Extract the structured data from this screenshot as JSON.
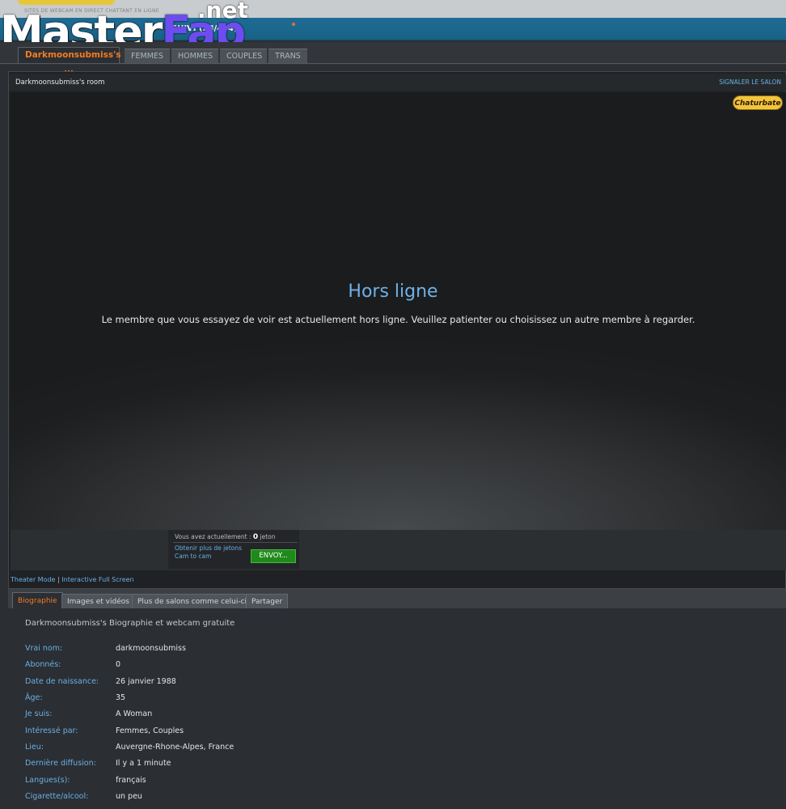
{
  "header": {
    "tagline": "SITES DE WEBCAM EN DIRECT CHATTANT EN LIGNE",
    "followed_label": "SUIVI (28/464)",
    "watermark_left": "Master",
    "watermark_fap": "Fap",
    "watermark_net": ".net"
  },
  "tabs": [
    {
      "label": "Darkmoonsubmiss's ...",
      "active": true
    },
    {
      "label": "FEMMES"
    },
    {
      "label": "HOMMES"
    },
    {
      "label": "COUPLES"
    },
    {
      "label": "TRANS"
    }
  ],
  "room": {
    "title": "Darkmoonsubmiss's room",
    "report_link": "SIGNALER LE SALON",
    "brand_logo": "Chaturbate",
    "offline_title": "Hors ligne",
    "offline_message": "Le membre que vous essayez de voir est actuellement hors ligne. Veuillez patienter ou choisissez un autre membre à regarder."
  },
  "tokens": {
    "prefix": "Vous avez actuellement :",
    "count": "0",
    "unit": "jeton",
    "get_more": "Obtenir plus de jetons",
    "cam_to_cam": "Cam to cam",
    "send_button": "ENVOY..."
  },
  "view_modes": {
    "theater": "Theater Mode",
    "separator": "|",
    "fullscreen": "Interactive Full Screen"
  },
  "bio_tabs": [
    {
      "label": "Biographie",
      "active": true
    },
    {
      "label": "Images et vidéos"
    },
    {
      "label": "Plus de salons comme celui-ci"
    },
    {
      "label": "Partager"
    }
  ],
  "bio": {
    "heading": "Darkmoonsubmiss's Biographie et webcam gratuite",
    "rows": [
      {
        "label": "Vrai nom:",
        "value": "darkmoonsubmiss"
      },
      {
        "label": "Abonnés:",
        "value": "0"
      },
      {
        "label": "Date de naissance:",
        "value": "26 janvier 1988"
      },
      {
        "label": "Âge:",
        "value": "35"
      },
      {
        "label": "Je suis:",
        "value": "A Woman"
      },
      {
        "label": "Intéressé par:",
        "value": "Femmes, Couples"
      },
      {
        "label": "Lieu:",
        "value": "Auvergne-Rhone-Alpes, France"
      },
      {
        "label": "Dernière diffusion:",
        "value": "Il y a 1 minute"
      },
      {
        "label": "Langues(s):",
        "value": "français"
      },
      {
        "label": "Cigarette/alcool:",
        "value": "un peu"
      }
    ]
  },
  "colors": {
    "accent_orange": "#f37c22",
    "link_blue": "#6ab0e4",
    "header_blue": "#1d6c95",
    "send_green": "#1f8a1a"
  }
}
